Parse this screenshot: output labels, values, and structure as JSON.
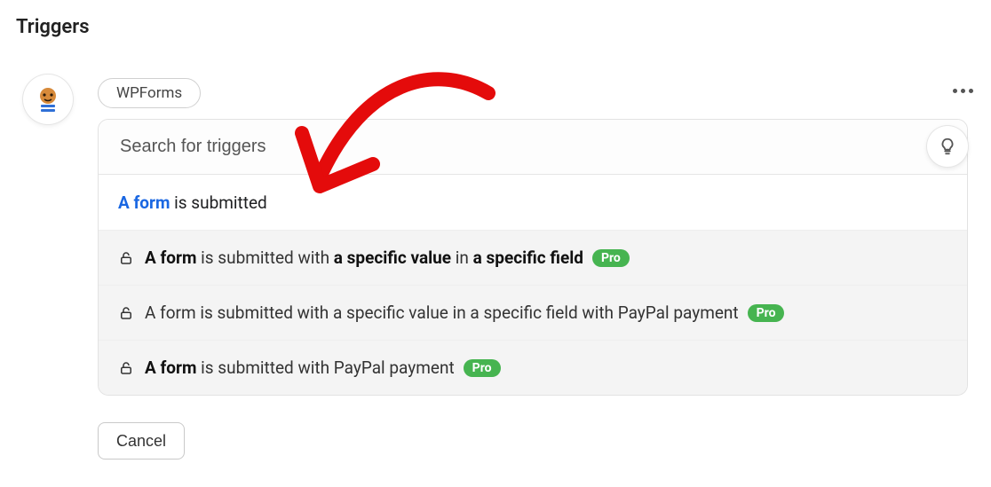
{
  "title": "Triggers",
  "integration_tag": "WPForms",
  "search": {
    "placeholder": "Search for triggers"
  },
  "cancel_label": "Cancel",
  "rows": [
    {
      "parts": [
        {
          "text": "A form",
          "style": "link"
        },
        {
          "text": " is submitted",
          "style": "plain"
        }
      ],
      "locked": false,
      "pro": false,
      "alt": false
    },
    {
      "parts": [
        {
          "text": "A form",
          "style": "bold"
        },
        {
          "text": " is submitted with ",
          "style": "plain"
        },
        {
          "text": "a specific value",
          "style": "bold"
        },
        {
          "text": " in ",
          "style": "plain"
        },
        {
          "text": "a specific field",
          "style": "bold"
        }
      ],
      "locked": true,
      "pro": true,
      "alt": true
    },
    {
      "parts": [
        {
          "text": "A form is submitted with a specific value in a specific field with PayPal payment",
          "style": "plain"
        }
      ],
      "locked": true,
      "pro": true,
      "alt": true
    },
    {
      "parts": [
        {
          "text": "A form",
          "style": "bold"
        },
        {
          "text": " is submitted with PayPal payment",
          "style": "plain"
        }
      ],
      "locked": true,
      "pro": true,
      "alt": true
    }
  ],
  "pro_label": "Pro"
}
